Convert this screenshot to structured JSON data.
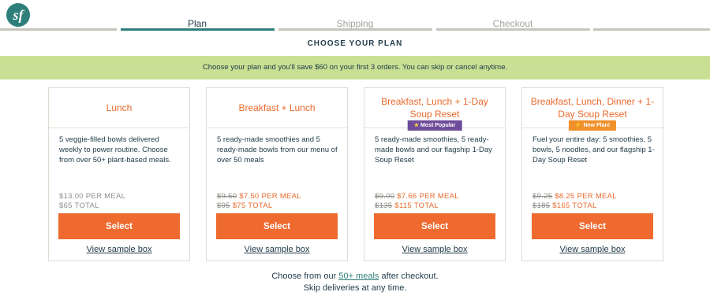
{
  "brand": {
    "logo_text": "sf",
    "color": "#2e7f7a"
  },
  "steps": [
    {
      "label": "Plan",
      "state": "active"
    },
    {
      "label": "Shipping",
      "state": "inactive"
    },
    {
      "label": "Checkout",
      "state": "inactive"
    }
  ],
  "heading": "CHOOSE YOUR PLAN",
  "banner": "Choose your plan and you'll save $60 on your first 3 orders. You can skip or cancel anytime.",
  "plans": [
    {
      "title": "Lunch",
      "badge": null,
      "description": "5 veggie-filled bowls delivered weekly to power routine. Choose from over 50+ plant-based meals.",
      "per_meal_old": "",
      "per_meal": "$13.00 PER MEAL",
      "total_old": "",
      "total": "$65 TOTAL",
      "select_label": "Select",
      "sample_label": "View sample box"
    },
    {
      "title": "Breakfast + Lunch",
      "badge": null,
      "description": "5 ready-made smoothies and 5 ready-made bowls from our menu of over 50 meals",
      "per_meal_old": "$9.50",
      "per_meal": "$7.50 PER MEAL",
      "total_old": "$95",
      "total": "$75 TOTAL",
      "select_label": "Select",
      "sample_label": "View sample box"
    },
    {
      "title": "Breakfast, Lunch + 1-Day Soup Reset",
      "badge": {
        "label": "Most Popular",
        "icon": "star-icon"
      },
      "description": "5 ready-made smoothies, 5 ready-made bowls and our flagship 1-Day Soup Reset",
      "per_meal_old": "$9.00",
      "per_meal": "$7.66 PER MEAL",
      "total_old": "$135",
      "total": "$115 TOTAL",
      "select_label": "Select",
      "sample_label": "View sample box"
    },
    {
      "title": "Breakfast, Lunch, Dinner + 1-Day Soup Reset",
      "badge": {
        "label": "New Plan!",
        "icon": "lightning-icon"
      },
      "description": "Fuel your entire day: 5 smoothies, 5 bowls, 5 noodles, and our flagship 1-Day Soup Reset",
      "per_meal_old": "$9.25",
      "per_meal": "$8.25 PER MEAL",
      "total_old": "$185",
      "total": "$165 TOTAL",
      "select_label": "Select",
      "sample_label": "View sample box"
    }
  ],
  "footer": {
    "line1_pre": "Choose from our ",
    "line1_link": "50+ meals",
    "line1_post": " after checkout.",
    "line2": "Skip deliveries at any time."
  },
  "colors": {
    "accent": "#ef6a2f",
    "banner": "#c9df94",
    "popular": "#6e4c9a",
    "new_badge": "#f0902a"
  }
}
